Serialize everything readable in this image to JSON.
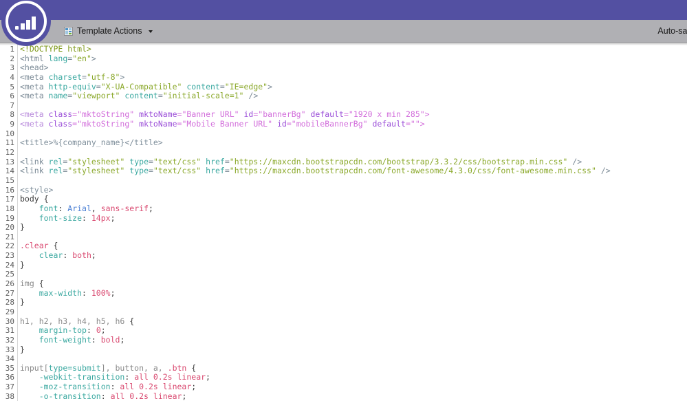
{
  "header": {
    "brand_logo_name": "marketo-logo",
    "bar_color": "#5350a2",
    "toolbar_color": "#b0b0b4"
  },
  "toolbar": {
    "template_actions_label": "Template Actions",
    "template_actions_icon": "template-grid-icon",
    "caret_icon": "chevron-down-icon",
    "autosave_label": "Auto-saved: M"
  },
  "editor": {
    "language": "html",
    "first_visible_line": 1,
    "line_numbers": [
      1,
      2,
      3,
      4,
      5,
      6,
      7,
      8,
      9,
      10,
      11,
      12,
      13,
      14,
      15,
      16,
      17,
      18,
      19,
      20,
      21,
      22,
      23,
      24,
      25,
      26,
      27,
      28,
      29,
      30,
      31,
      32,
      33,
      34,
      35,
      36,
      37,
      38
    ],
    "lines": [
      [
        {
          "t": "<!DOCTYPE html>",
          "c": "t-doctype"
        }
      ],
      [
        {
          "t": "<html ",
          "c": "t-tag"
        },
        {
          "t": "lang",
          "c": "t-attr"
        },
        {
          "t": "=",
          "c": "t-tag"
        },
        {
          "t": "\"en\"",
          "c": "t-str"
        },
        {
          "t": ">",
          "c": "t-tag"
        }
      ],
      [
        {
          "t": "<head>",
          "c": "t-tag"
        }
      ],
      [
        {
          "t": "<meta ",
          "c": "t-tag"
        },
        {
          "t": "charset",
          "c": "t-attr"
        },
        {
          "t": "=",
          "c": "t-tag"
        },
        {
          "t": "\"utf-8\"",
          "c": "t-str"
        },
        {
          "t": ">",
          "c": "t-tag"
        }
      ],
      [
        {
          "t": "<meta ",
          "c": "t-tag"
        },
        {
          "t": "http-equiv",
          "c": "t-attr"
        },
        {
          "t": "=",
          "c": "t-tag"
        },
        {
          "t": "\"X-UA-Compatible\"",
          "c": "t-str"
        },
        {
          "t": " ",
          "c": "t-tag"
        },
        {
          "t": "content",
          "c": "t-attr"
        },
        {
          "t": "=",
          "c": "t-tag"
        },
        {
          "t": "\"IE=edge\"",
          "c": "t-str"
        },
        {
          "t": ">",
          "c": "t-tag"
        }
      ],
      [
        {
          "t": "<meta ",
          "c": "t-tag"
        },
        {
          "t": "name",
          "c": "t-attr"
        },
        {
          "t": "=",
          "c": "t-tag"
        },
        {
          "t": "\"viewport\"",
          "c": "t-str"
        },
        {
          "t": " ",
          "c": "t-tag"
        },
        {
          "t": "content",
          "c": "t-attr"
        },
        {
          "t": "=",
          "c": "t-tag"
        },
        {
          "t": "\"initial-scale=1\"",
          "c": "t-str"
        },
        {
          "t": " />",
          "c": "t-tag"
        }
      ],
      [],
      [
        {
          "t": "<meta ",
          "c": "t-tag2"
        },
        {
          "t": "class",
          "c": "t-attr2"
        },
        {
          "t": "=",
          "c": "t-str2"
        },
        {
          "t": "\"mktoString\"",
          "c": "t-str2"
        },
        {
          "t": " ",
          "c": "t-str2"
        },
        {
          "t": "mktoName",
          "c": "t-attr2"
        },
        {
          "t": "=",
          "c": "t-str2"
        },
        {
          "t": "\"Banner URL\"",
          "c": "t-str2"
        },
        {
          "t": " ",
          "c": "t-str2"
        },
        {
          "t": "id",
          "c": "t-attr2"
        },
        {
          "t": "=",
          "c": "t-str2"
        },
        {
          "t": "\"bannerBg\"",
          "c": "t-str2"
        },
        {
          "t": " ",
          "c": "t-str2"
        },
        {
          "t": "default",
          "c": "t-attr2"
        },
        {
          "t": "=",
          "c": "t-str2"
        },
        {
          "t": "\"1920 x min 285\"",
          "c": "t-str2"
        },
        {
          "t": ">",
          "c": "t-str2"
        }
      ],
      [
        {
          "t": "<meta ",
          "c": "t-tag2"
        },
        {
          "t": "class",
          "c": "t-attr2"
        },
        {
          "t": "=",
          "c": "t-str2"
        },
        {
          "t": "\"mktoString\"",
          "c": "t-str2"
        },
        {
          "t": " ",
          "c": "t-str2"
        },
        {
          "t": "mktoName",
          "c": "t-attr2"
        },
        {
          "t": "=",
          "c": "t-str2"
        },
        {
          "t": "\"Mobile Banner URL\"",
          "c": "t-str2"
        },
        {
          "t": " ",
          "c": "t-str2"
        },
        {
          "t": "id",
          "c": "t-attr2"
        },
        {
          "t": "=",
          "c": "t-str2"
        },
        {
          "t": "\"mobileBannerBg\"",
          "c": "t-str2"
        },
        {
          "t": " ",
          "c": "t-str2"
        },
        {
          "t": "default",
          "c": "t-attr2"
        },
        {
          "t": "=",
          "c": "t-str2"
        },
        {
          "t": "\"\"",
          "c": "t-str2"
        },
        {
          "t": ">",
          "c": "t-str2"
        }
      ],
      [],
      [
        {
          "t": "<title>%{company_name}</title>",
          "c": "t-plain"
        }
      ],
      [],
      [
        {
          "t": "<link ",
          "c": "t-tag"
        },
        {
          "t": "rel",
          "c": "t-attr"
        },
        {
          "t": "=",
          "c": "t-tag"
        },
        {
          "t": "\"stylesheet\"",
          "c": "t-str"
        },
        {
          "t": " ",
          "c": "t-tag"
        },
        {
          "t": "type",
          "c": "t-attr"
        },
        {
          "t": "=",
          "c": "t-tag"
        },
        {
          "t": "\"text/css\"",
          "c": "t-str"
        },
        {
          "t": " ",
          "c": "t-tag"
        },
        {
          "t": "href",
          "c": "t-attr"
        },
        {
          "t": "=",
          "c": "t-tag"
        },
        {
          "t": "\"https://maxcdn.bootstrapcdn.com/bootstrap/3.3.2/css/bootstrap.min.css\"",
          "c": "t-str"
        },
        {
          "t": " />",
          "c": "t-tag"
        }
      ],
      [
        {
          "t": "<link ",
          "c": "t-tag"
        },
        {
          "t": "rel",
          "c": "t-attr"
        },
        {
          "t": "=",
          "c": "t-tag"
        },
        {
          "t": "\"stylesheet\"",
          "c": "t-str"
        },
        {
          "t": " ",
          "c": "t-tag"
        },
        {
          "t": "type",
          "c": "t-attr"
        },
        {
          "t": "=",
          "c": "t-tag"
        },
        {
          "t": "\"text/css\"",
          "c": "t-str"
        },
        {
          "t": " ",
          "c": "t-tag"
        },
        {
          "t": "href",
          "c": "t-attr"
        },
        {
          "t": "=",
          "c": "t-tag"
        },
        {
          "t": "\"https://maxcdn.bootstrapcdn.com/font-awesome/4.3.0/css/font-awesome.min.css\"",
          "c": "t-str"
        },
        {
          "t": " />",
          "c": "t-tag"
        }
      ],
      [],
      [
        {
          "t": "<style>",
          "c": "t-plain"
        }
      ],
      [
        {
          "t": "body {",
          "c": "t-punct"
        }
      ],
      [
        {
          "t": "    ",
          "c": "t-punct"
        },
        {
          "t": "font",
          "c": "t-prop"
        },
        {
          "t": ": ",
          "c": "t-punct"
        },
        {
          "t": "Arial",
          "c": "t-valblue"
        },
        {
          "t": ", ",
          "c": "t-punct"
        },
        {
          "t": "sans-serif",
          "c": "t-val"
        },
        {
          "t": ";",
          "c": "t-punct"
        }
      ],
      [
        {
          "t": "    ",
          "c": "t-punct"
        },
        {
          "t": "font-size",
          "c": "t-prop"
        },
        {
          "t": ": ",
          "c": "t-punct"
        },
        {
          "t": "14px",
          "c": "t-val"
        },
        {
          "t": ";",
          "c": "t-punct"
        }
      ],
      [
        {
          "t": "}",
          "c": "t-punct"
        }
      ],
      [],
      [
        {
          "t": ".clear",
          "c": "t-class"
        },
        {
          "t": " {",
          "c": "t-punct"
        }
      ],
      [
        {
          "t": "    ",
          "c": "t-punct"
        },
        {
          "t": "clear",
          "c": "t-prop"
        },
        {
          "t": ": ",
          "c": "t-punct"
        },
        {
          "t": "both",
          "c": "t-val"
        },
        {
          "t": ";",
          "c": "t-punct"
        }
      ],
      [
        {
          "t": "}",
          "c": "t-punct"
        }
      ],
      [],
      [
        {
          "t": "img",
          "c": "t-sel"
        },
        {
          "t": " {",
          "c": "t-punct"
        }
      ],
      [
        {
          "t": "    ",
          "c": "t-punct"
        },
        {
          "t": "max-width",
          "c": "t-prop"
        },
        {
          "t": ": ",
          "c": "t-punct"
        },
        {
          "t": "100%",
          "c": "t-val"
        },
        {
          "t": ";",
          "c": "t-punct"
        }
      ],
      [
        {
          "t": "}",
          "c": "t-punct"
        }
      ],
      [],
      [
        {
          "t": "h1, h2, h3, h4, h5, h6",
          "c": "t-sel"
        },
        {
          "t": " {",
          "c": "t-punct"
        }
      ],
      [
        {
          "t": "    ",
          "c": "t-punct"
        },
        {
          "t": "margin-top",
          "c": "t-prop"
        },
        {
          "t": ": ",
          "c": "t-punct"
        },
        {
          "t": "0",
          "c": "t-val"
        },
        {
          "t": ";",
          "c": "t-punct"
        }
      ],
      [
        {
          "t": "    ",
          "c": "t-punct"
        },
        {
          "t": "font-weight",
          "c": "t-prop"
        },
        {
          "t": ": ",
          "c": "t-punct"
        },
        {
          "t": "bold",
          "c": "t-val"
        },
        {
          "t": ";",
          "c": "t-punct"
        }
      ],
      [
        {
          "t": "}",
          "c": "t-punct"
        }
      ],
      [],
      [
        {
          "t": "input[",
          "c": "t-sel"
        },
        {
          "t": "type=submit",
          "c": "t-prop"
        },
        {
          "t": "], button, a, ",
          "c": "t-sel"
        },
        {
          "t": ".btn",
          "c": "t-class"
        },
        {
          "t": " {",
          "c": "t-punct"
        }
      ],
      [
        {
          "t": "    ",
          "c": "t-punct"
        },
        {
          "t": "-webkit-transition",
          "c": "t-prop"
        },
        {
          "t": ": ",
          "c": "t-punct"
        },
        {
          "t": "all 0.2s linear",
          "c": "t-val"
        },
        {
          "t": ";",
          "c": "t-punct"
        }
      ],
      [
        {
          "t": "    ",
          "c": "t-punct"
        },
        {
          "t": "-moz-transition",
          "c": "t-prop"
        },
        {
          "t": ": ",
          "c": "t-punct"
        },
        {
          "t": "all 0.2s linear",
          "c": "t-val"
        },
        {
          "t": ";",
          "c": "t-punct"
        }
      ],
      [
        {
          "t": "    ",
          "c": "t-punct"
        },
        {
          "t": "-o-transition",
          "c": "t-prop"
        },
        {
          "t": ": ",
          "c": "t-punct"
        },
        {
          "t": "all 0.2s linear",
          "c": "t-val"
        },
        {
          "t": ";",
          "c": "t-punct"
        }
      ]
    ]
  }
}
